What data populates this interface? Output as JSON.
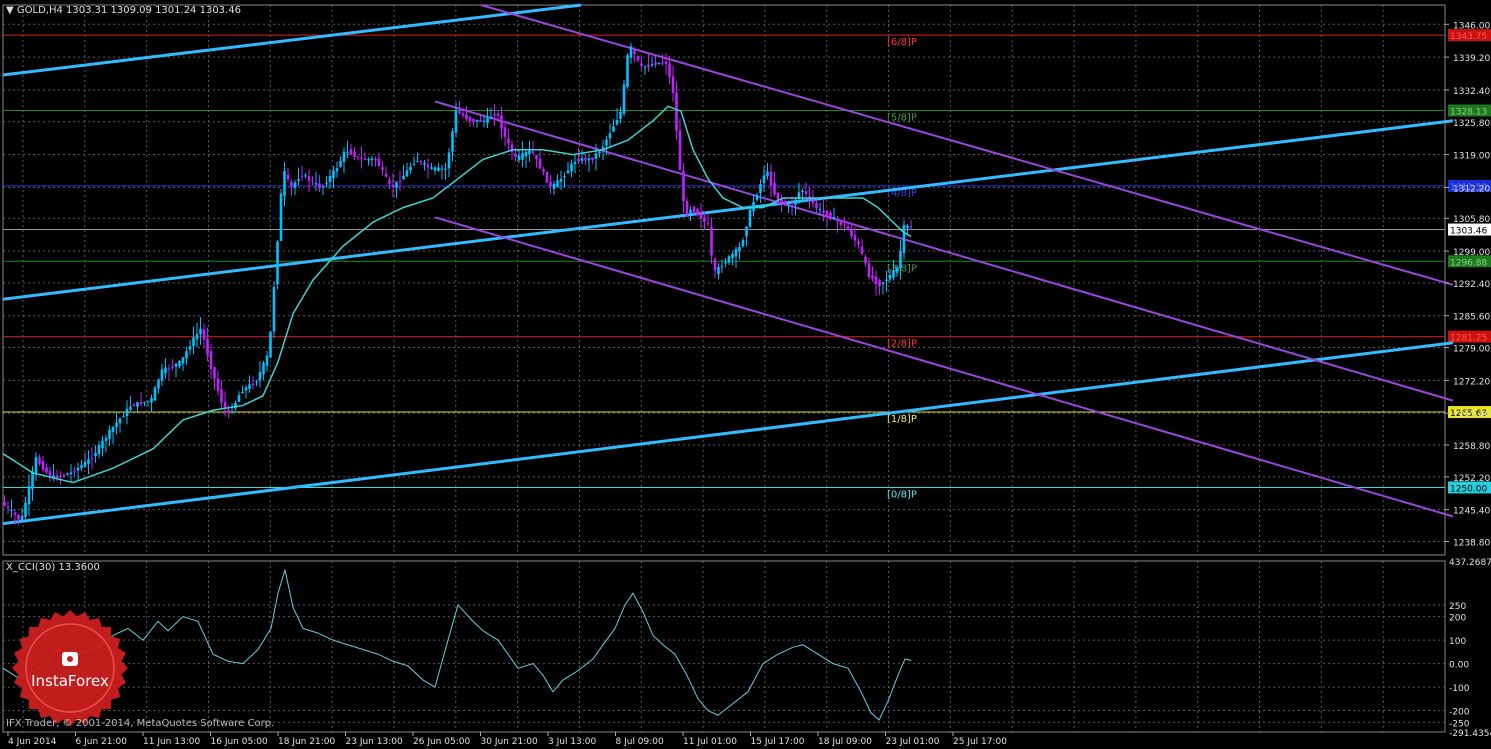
{
  "header": {
    "symbol_line": "GOLD,H4  1303.31 1309.09 1301.24 1303.46"
  },
  "indicator": {
    "label": "X_CCI(30) 13.3600"
  },
  "footer": {
    "copyright": "IFX Trader, © 2001-2014, MetaQuotes Software Corp."
  },
  "logo": {
    "text": "InstaForex"
  },
  "colors": {
    "background": "#000000",
    "bull_candle": "#00bfff",
    "bear_candle": "#c020ff",
    "ma_line": "#40d0d0",
    "trend_blue": "#33bbff",
    "channel_purple": "#9a46dd",
    "cci_line": "#66ccdd",
    "grid": "#5a5a5a",
    "axis_text": "#e0e0e0",
    "logo_red": "#cc1f1f"
  },
  "chart_data": [
    {
      "type": "candlestick",
      "title": "GOLD,H4",
      "ylim": [
        1236,
        1350
      ],
      "y_ticks": [
        "1346.00",
        "1339.20",
        "1332.40",
        "1325.80",
        "1319.00",
        "1312.20",
        "1305.80",
        "1299.00",
        "1292.40",
        "1285.60",
        "1279.00",
        "1272.20",
        "1265.40",
        "1258.80",
        "1252.20",
        "1245.40",
        "1238.80"
      ],
      "x_ticks": [
        "4 Jun 2014",
        "6 Jun 21:00",
        "11 Jun 13:00",
        "16 Jun 05:00",
        "18 Jun 21:00",
        "23 Jun 13:00",
        "26 Jun 05:00",
        "30 Jun 21:00",
        "3 Jul 13:00",
        "8 Jul 09:00",
        "11 Jul 01:00",
        "15 Jul 17:00",
        "18 Jul 09:00",
        "23 Jul 01:00",
        "25 Jul 17:00"
      ],
      "last_price": {
        "value": "1303.46",
        "y": 1303.46
      },
      "price_path": [
        [
          0,
          1247
        ],
        [
          10,
          1245
        ],
        [
          20,
          1243
        ],
        [
          35,
          1256
        ],
        [
          50,
          1252
        ],
        [
          70,
          1253
        ],
        [
          90,
          1256
        ],
        [
          110,
          1262
        ],
        [
          130,
          1267
        ],
        [
          150,
          1268
        ],
        [
          160,
          1274
        ],
        [
          180,
          1276
        ],
        [
          190,
          1280
        ],
        [
          200,
          1283
        ],
        [
          210,
          1275
        ],
        [
          220,
          1268
        ],
        [
          228,
          1265
        ],
        [
          240,
          1270
        ],
        [
          255,
          1272
        ],
        [
          268,
          1278
        ],
        [
          276,
          1300
        ],
        [
          282,
          1316
        ],
        [
          290,
          1312
        ],
        [
          300,
          1315
        ],
        [
          320,
          1312
        ],
        [
          335,
          1316
        ],
        [
          345,
          1320
        ],
        [
          360,
          1318
        ],
        [
          375,
          1318
        ],
        [
          390,
          1312
        ],
        [
          400,
          1314
        ],
        [
          415,
          1318
        ],
        [
          430,
          1316
        ],
        [
          445,
          1316
        ],
        [
          455,
          1328
        ],
        [
          470,
          1326
        ],
        [
          485,
          1326
        ],
        [
          495,
          1328
        ],
        [
          505,
          1322
        ],
        [
          515,
          1318
        ],
        [
          530,
          1320
        ],
        [
          540,
          1316
        ],
        [
          550,
          1312
        ],
        [
          560,
          1314
        ],
        [
          575,
          1318
        ],
        [
          590,
          1318
        ],
        [
          600,
          1320
        ],
        [
          610,
          1324
        ],
        [
          620,
          1328
        ],
        [
          628,
          1342
        ],
        [
          640,
          1337
        ],
        [
          655,
          1338
        ],
        [
          665,
          1338
        ],
        [
          672,
          1332
        ],
        [
          678,
          1318
        ],
        [
          684,
          1306
        ],
        [
          690,
          1308
        ],
        [
          700,
          1306
        ],
        [
          708,
          1304
        ],
        [
          712,
          1294
        ],
        [
          720,
          1296
        ],
        [
          730,
          1298
        ],
        [
          740,
          1300
        ],
        [
          750,
          1308
        ],
        [
          758,
          1312
        ],
        [
          765,
          1316
        ],
        [
          775,
          1310
        ],
        [
          790,
          1308
        ],
        [
          800,
          1312
        ],
        [
          815,
          1308
        ],
        [
          830,
          1306
        ],
        [
          845,
          1304
        ],
        [
          858,
          1300
        ],
        [
          868,
          1294
        ],
        [
          878,
          1292
        ],
        [
          890,
          1294
        ],
        [
          898,
          1296
        ],
        [
          902,
          1304
        ],
        [
          908,
          1304
        ]
      ],
      "ma_path": [
        [
          0,
          1257
        ],
        [
          30,
          1253
        ],
        [
          70,
          1251
        ],
        [
          110,
          1254
        ],
        [
          150,
          1258
        ],
        [
          180,
          1264
        ],
        [
          210,
          1266
        ],
        [
          240,
          1267
        ],
        [
          260,
          1269
        ],
        [
          275,
          1276
        ],
        [
          290,
          1286
        ],
        [
          310,
          1293
        ],
        [
          340,
          1300
        ],
        [
          370,
          1305
        ],
        [
          400,
          1308
        ],
        [
          430,
          1310
        ],
        [
          455,
          1314
        ],
        [
          480,
          1318
        ],
        [
          510,
          1320
        ],
        [
          540,
          1320
        ],
        [
          570,
          1319
        ],
        [
          600,
          1320
        ],
        [
          625,
          1322
        ],
        [
          650,
          1326
        ],
        [
          665,
          1329
        ],
        [
          678,
          1328
        ],
        [
          690,
          1320
        ],
        [
          705,
          1314
        ],
        [
          720,
          1310
        ],
        [
          740,
          1308
        ],
        [
          760,
          1308
        ],
        [
          780,
          1310
        ],
        [
          800,
          1310
        ],
        [
          820,
          1310
        ],
        [
          840,
          1310
        ],
        [
          860,
          1310
        ],
        [
          875,
          1308
        ],
        [
          890,
          1305
        ],
        [
          900,
          1303
        ],
        [
          908,
          1302
        ]
      ],
      "murrey_levels": [
        {
          "label": "[6/8]P",
          "value": "1343.75",
          "y": 1343.75,
          "color": "#dd2222",
          "text_color": "#ff3333",
          "tag_bg": "#cc1111",
          "tag_fg": "#ff5555"
        },
        {
          "label": "[5/8]P",
          "value": "1328.13",
          "y": 1328.13,
          "color": "#1c8a1c",
          "text_color": "#4a9a4a",
          "tag_bg": "#1f7a1f",
          "tag_fg": "#88cc88"
        },
        {
          "label": "[4/8]P",
          "value": "1312.50",
          "y": 1312.5,
          "color": "#2233dd",
          "text_color": "#3344ee",
          "tag_bg": "#1a2ed8",
          "tag_fg": "#6b7bff"
        },
        {
          "label": "[3/8]P",
          "value": "1296.88",
          "y": 1296.88,
          "color": "#1c8a1c",
          "text_color": "#4a9a4a",
          "tag_bg": "#1f7a1f",
          "tag_fg": "#88cc88"
        },
        {
          "label": "[2/8]P",
          "value": "1281.25",
          "y": 1281.25,
          "color": "#dd2222",
          "text_color": "#ff3333",
          "tag_bg": "#cc1111",
          "tag_fg": "#ff5555"
        },
        {
          "label": "[1/8]P",
          "value": "1265.63",
          "y": 1265.63,
          "color": "#dddd33",
          "text_color": "#eeee55",
          "tag_bg": "#e6e61a",
          "tag_fg": "#000000"
        },
        {
          "label": "[0/8]P",
          "value": "1250.00",
          "y": 1250.0,
          "color": "#33dddd",
          "text_color": "#55eeee",
          "tag_bg": "#22d0e0",
          "tag_fg": "#000000"
        }
      ],
      "trend_lines": [
        {
          "color": "#33bbff",
          "points": [
            [
              0,
              1335.5
            ],
            [
              578,
              1350
            ]
          ]
        },
        {
          "color": "#33bbff",
          "points": [
            [
              0,
              1289
            ],
            [
              1450,
              1326
            ]
          ]
        },
        {
          "color": "#33bbff",
          "points": [
            [
              0,
              1242.5
            ],
            [
              1450,
              1280
            ]
          ]
        },
        {
          "color": "#9a46dd",
          "points": [
            [
              478,
              1350
            ],
            [
              1450,
              1292
            ]
          ]
        },
        {
          "color": "#9a46dd",
          "points": [
            [
              432,
              1330
            ],
            [
              1450,
              1268
            ]
          ]
        },
        {
          "color": "#9a46dd",
          "points": [
            [
              432,
              1306
            ],
            [
              1450,
              1244
            ]
          ]
        }
      ]
    },
    {
      "type": "line",
      "title": "X_CCI(30) 13.3600",
      "ylim": [
        -291.4354,
        437.2687
      ],
      "y_ticks": [
        "437.2687",
        "250",
        "200",
        "100",
        "0.00",
        "-100",
        "-200",
        "-250",
        "-291.4354"
      ],
      "series": [
        {
          "name": "",
          "points": [
            [
              0,
              -20
            ],
            [
              15,
              -60
            ],
            [
              25,
              -40
            ],
            [
              40,
              -10
            ],
            [
              55,
              60
            ],
            [
              75,
              40
            ],
            [
              95,
              70
            ],
            [
              110,
              120
            ],
            [
              125,
              150
            ],
            [
              140,
              100
            ],
            [
              155,
              180
            ],
            [
              165,
              140
            ],
            [
              180,
              200
            ],
            [
              195,
              180
            ],
            [
              210,
              40
            ],
            [
              225,
              10
            ],
            [
              240,
              0
            ],
            [
              255,
              60
            ],
            [
              268,
              150
            ],
            [
              275,
              300
            ],
            [
              282,
              400
            ],
            [
              290,
              240
            ],
            [
              300,
              150
            ],
            [
              315,
              130
            ],
            [
              330,
              100
            ],
            [
              345,
              80
            ],
            [
              360,
              60
            ],
            [
              375,
              40
            ],
            [
              390,
              10
            ],
            [
              405,
              -10
            ],
            [
              420,
              -70
            ],
            [
              432,
              -100
            ],
            [
              445,
              100
            ],
            [
              455,
              250
            ],
            [
              470,
              180
            ],
            [
              480,
              140
            ],
            [
              495,
              100
            ],
            [
              505,
              40
            ],
            [
              515,
              -20
            ],
            [
              530,
              0
            ],
            [
              540,
              -50
            ],
            [
              550,
              -120
            ],
            [
              560,
              -70
            ],
            [
              575,
              -30
            ],
            [
              590,
              20
            ],
            [
              600,
              80
            ],
            [
              612,
              150
            ],
            [
              622,
              250
            ],
            [
              630,
              300
            ],
            [
              640,
              220
            ],
            [
              650,
              120
            ],
            [
              660,
              80
            ],
            [
              672,
              40
            ],
            [
              684,
              -50
            ],
            [
              695,
              -150
            ],
            [
              705,
              -200
            ],
            [
              715,
              -220
            ],
            [
              730,
              -170
            ],
            [
              745,
              -120
            ],
            [
              760,
              0
            ],
            [
              775,
              40
            ],
            [
              790,
              70
            ],
            [
              800,
              80
            ],
            [
              815,
              40
            ],
            [
              830,
              0
            ],
            [
              845,
              -20
            ],
            [
              858,
              -120
            ],
            [
              868,
              -210
            ],
            [
              876,
              -240
            ],
            [
              885,
              -160
            ],
            [
              895,
              -50
            ],
            [
              902,
              20
            ],
            [
              908,
              13.36
            ]
          ]
        }
      ]
    }
  ]
}
